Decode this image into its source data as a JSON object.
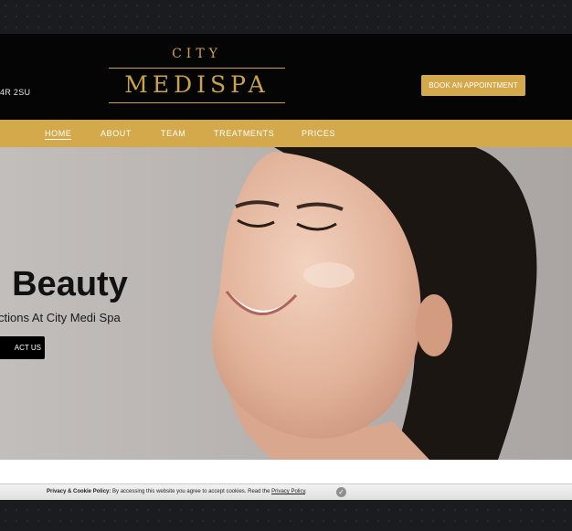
{
  "header": {
    "postcode": "4R 2SU",
    "logo_top": "CITY",
    "logo_main": "MEDISPA",
    "book_button": "BOOK AN APPOINTMENT"
  },
  "nav": {
    "items": [
      "HOME",
      "ABOUT",
      "TEAM",
      "TREATMENTS",
      "PRICES"
    ],
    "active": "HOME"
  },
  "hero": {
    "title": "l Beauty",
    "subtitle": "ctions At City Medi Spa",
    "cta": "ACT US"
  },
  "cookie": {
    "label": "Privacy & Cookie Policy:",
    "text": " By accessing this website you agree to accept cookies. Read the ",
    "link": "Privacy Policy",
    "tail": "."
  },
  "colors": {
    "gold": "#d4a94b",
    "header_bg": "#050505"
  }
}
